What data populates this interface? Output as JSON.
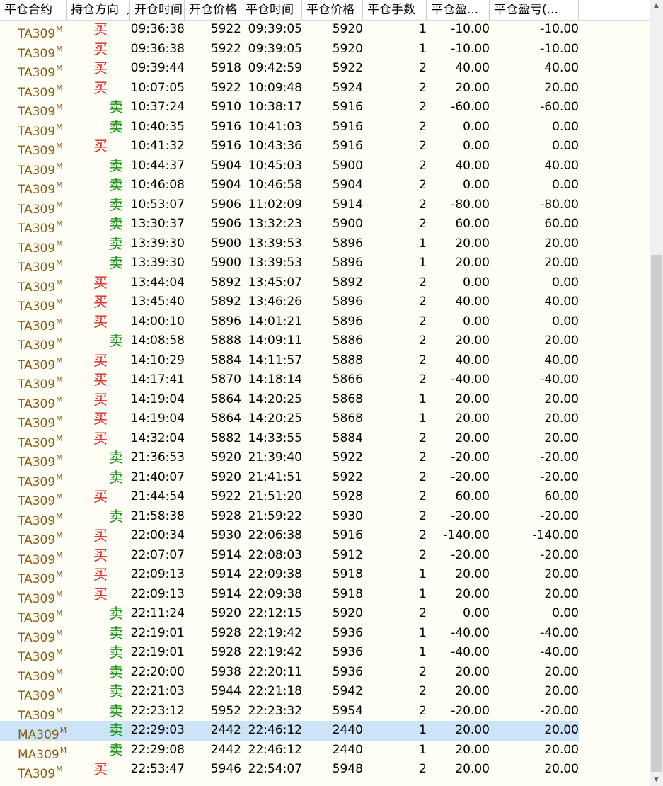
{
  "headers": {
    "contract": "平仓合约",
    "direction": "持仓方向",
    "open_time": "开仓时间",
    "open_price": "开仓价格",
    "close_time": "平仓时间",
    "close_price": "平仓价格",
    "lots": "平仓手数",
    "pnl": "平仓盈...",
    "pnl2": "平仓盈亏(..."
  },
  "rows": [
    {
      "contract": "TA309",
      "sup": "M",
      "dir": "买",
      "side": "buy",
      "otime": "09:36:38",
      "oprice": "5922",
      "ctime": "09:39:05",
      "cprice": "5920",
      "lots": "1",
      "pnl": "-10.00",
      "pnl2": "-10.00"
    },
    {
      "contract": "TA309",
      "sup": "M",
      "dir": "买",
      "side": "buy",
      "otime": "09:36:38",
      "oprice": "5922",
      "ctime": "09:39:05",
      "cprice": "5920",
      "lots": "1",
      "pnl": "-10.00",
      "pnl2": "-10.00"
    },
    {
      "contract": "TA309",
      "sup": "M",
      "dir": "买",
      "side": "buy",
      "otime": "09:39:44",
      "oprice": "5918",
      "ctime": "09:42:59",
      "cprice": "5922",
      "lots": "2",
      "pnl": "40.00",
      "pnl2": "40.00"
    },
    {
      "contract": "TA309",
      "sup": "M",
      "dir": "买",
      "side": "buy",
      "otime": "10:07:05",
      "oprice": "5922",
      "ctime": "10:09:48",
      "cprice": "5924",
      "lots": "2",
      "pnl": "20.00",
      "pnl2": "20.00"
    },
    {
      "contract": "TA309",
      "sup": "M",
      "dir": "卖",
      "side": "sell",
      "otime": "10:37:24",
      "oprice": "5910",
      "ctime": "10:38:17",
      "cprice": "5916",
      "lots": "2",
      "pnl": "-60.00",
      "pnl2": "-60.00"
    },
    {
      "contract": "TA309",
      "sup": "M",
      "dir": "卖",
      "side": "sell",
      "otime": "10:40:35",
      "oprice": "5916",
      "ctime": "10:41:03",
      "cprice": "5916",
      "lots": "2",
      "pnl": "0.00",
      "pnl2": "0.00"
    },
    {
      "contract": "TA309",
      "sup": "M",
      "dir": "买",
      "side": "buy",
      "otime": "10:41:32",
      "oprice": "5916",
      "ctime": "10:43:36",
      "cprice": "5916",
      "lots": "2",
      "pnl": "0.00",
      "pnl2": "0.00"
    },
    {
      "contract": "TA309",
      "sup": "M",
      "dir": "卖",
      "side": "sell",
      "otime": "10:44:37",
      "oprice": "5904",
      "ctime": "10:45:03",
      "cprice": "5900",
      "lots": "2",
      "pnl": "40.00",
      "pnl2": "40.00"
    },
    {
      "contract": "TA309",
      "sup": "M",
      "dir": "卖",
      "side": "sell",
      "otime": "10:46:08",
      "oprice": "5904",
      "ctime": "10:46:58",
      "cprice": "5904",
      "lots": "2",
      "pnl": "0.00",
      "pnl2": "0.00"
    },
    {
      "contract": "TA309",
      "sup": "M",
      "dir": "卖",
      "side": "sell",
      "otime": "10:53:07",
      "oprice": "5906",
      "ctime": "11:02:09",
      "cprice": "5914",
      "lots": "2",
      "pnl": "-80.00",
      "pnl2": "-80.00"
    },
    {
      "contract": "TA309",
      "sup": "M",
      "dir": "卖",
      "side": "sell",
      "otime": "13:30:37",
      "oprice": "5906",
      "ctime": "13:32:23",
      "cprice": "5900",
      "lots": "2",
      "pnl": "60.00",
      "pnl2": "60.00"
    },
    {
      "contract": "TA309",
      "sup": "M",
      "dir": "卖",
      "side": "sell",
      "otime": "13:39:30",
      "oprice": "5900",
      "ctime": "13:39:53",
      "cprice": "5896",
      "lots": "1",
      "pnl": "20.00",
      "pnl2": "20.00"
    },
    {
      "contract": "TA309",
      "sup": "M",
      "dir": "卖",
      "side": "sell",
      "otime": "13:39:30",
      "oprice": "5900",
      "ctime": "13:39:53",
      "cprice": "5896",
      "lots": "1",
      "pnl": "20.00",
      "pnl2": "20.00"
    },
    {
      "contract": "TA309",
      "sup": "M",
      "dir": "买",
      "side": "buy",
      "otime": "13:44:04",
      "oprice": "5892",
      "ctime": "13:45:07",
      "cprice": "5892",
      "lots": "2",
      "pnl": "0.00",
      "pnl2": "0.00"
    },
    {
      "contract": "TA309",
      "sup": "M",
      "dir": "买",
      "side": "buy",
      "otime": "13:45:40",
      "oprice": "5892",
      "ctime": "13:46:26",
      "cprice": "5896",
      "lots": "2",
      "pnl": "40.00",
      "pnl2": "40.00"
    },
    {
      "contract": "TA309",
      "sup": "M",
      "dir": "买",
      "side": "buy",
      "otime": "14:00:10",
      "oprice": "5896",
      "ctime": "14:01:21",
      "cprice": "5896",
      "lots": "2",
      "pnl": "0.00",
      "pnl2": "0.00"
    },
    {
      "contract": "TA309",
      "sup": "M",
      "dir": "卖",
      "side": "sell",
      "otime": "14:08:58",
      "oprice": "5888",
      "ctime": "14:09:11",
      "cprice": "5886",
      "lots": "2",
      "pnl": "20.00",
      "pnl2": "20.00"
    },
    {
      "contract": "TA309",
      "sup": "M",
      "dir": "买",
      "side": "buy",
      "otime": "14:10:29",
      "oprice": "5884",
      "ctime": "14:11:57",
      "cprice": "5888",
      "lots": "2",
      "pnl": "40.00",
      "pnl2": "40.00"
    },
    {
      "contract": "TA309",
      "sup": "M",
      "dir": "买",
      "side": "buy",
      "otime": "14:17:41",
      "oprice": "5870",
      "ctime": "14:18:14",
      "cprice": "5866",
      "lots": "2",
      "pnl": "-40.00",
      "pnl2": "-40.00"
    },
    {
      "contract": "TA309",
      "sup": "M",
      "dir": "买",
      "side": "buy",
      "otime": "14:19:04",
      "oprice": "5864",
      "ctime": "14:20:25",
      "cprice": "5868",
      "lots": "1",
      "pnl": "20.00",
      "pnl2": "20.00"
    },
    {
      "contract": "TA309",
      "sup": "M",
      "dir": "买",
      "side": "buy",
      "otime": "14:19:04",
      "oprice": "5864",
      "ctime": "14:20:25",
      "cprice": "5868",
      "lots": "1",
      "pnl": "20.00",
      "pnl2": "20.00"
    },
    {
      "contract": "TA309",
      "sup": "M",
      "dir": "买",
      "side": "buy",
      "otime": "14:32:04",
      "oprice": "5882",
      "ctime": "14:33:55",
      "cprice": "5884",
      "lots": "2",
      "pnl": "20.00",
      "pnl2": "20.00"
    },
    {
      "contract": "TA309",
      "sup": "M",
      "dir": "卖",
      "side": "sell",
      "otime": "21:36:53",
      "oprice": "5920",
      "ctime": "21:39:40",
      "cprice": "5922",
      "lots": "2",
      "pnl": "-20.00",
      "pnl2": "-20.00"
    },
    {
      "contract": "TA309",
      "sup": "M",
      "dir": "卖",
      "side": "sell",
      "otime": "21:40:07",
      "oprice": "5920",
      "ctime": "21:41:51",
      "cprice": "5922",
      "lots": "2",
      "pnl": "-20.00",
      "pnl2": "-20.00"
    },
    {
      "contract": "TA309",
      "sup": "M",
      "dir": "买",
      "side": "buy",
      "otime": "21:44:54",
      "oprice": "5922",
      "ctime": "21:51:20",
      "cprice": "5928",
      "lots": "2",
      "pnl": "60.00",
      "pnl2": "60.00"
    },
    {
      "contract": "TA309",
      "sup": "M",
      "dir": "卖",
      "side": "sell",
      "otime": "21:58:38",
      "oprice": "5928",
      "ctime": "21:59:22",
      "cprice": "5930",
      "lots": "2",
      "pnl": "-20.00",
      "pnl2": "-20.00"
    },
    {
      "contract": "TA309",
      "sup": "M",
      "dir": "买",
      "side": "buy",
      "otime": "22:00:34",
      "oprice": "5930",
      "ctime": "22:06:38",
      "cprice": "5916",
      "lots": "2",
      "pnl": "-140.00",
      "pnl2": "-140.00"
    },
    {
      "contract": "TA309",
      "sup": "M",
      "dir": "买",
      "side": "buy",
      "otime": "22:07:07",
      "oprice": "5914",
      "ctime": "22:08:03",
      "cprice": "5912",
      "lots": "2",
      "pnl": "-20.00",
      "pnl2": "-20.00"
    },
    {
      "contract": "TA309",
      "sup": "M",
      "dir": "买",
      "side": "buy",
      "otime": "22:09:13",
      "oprice": "5914",
      "ctime": "22:09:38",
      "cprice": "5918",
      "lots": "1",
      "pnl": "20.00",
      "pnl2": "20.00"
    },
    {
      "contract": "TA309",
      "sup": "M",
      "dir": "买",
      "side": "buy",
      "otime": "22:09:13",
      "oprice": "5914",
      "ctime": "22:09:38",
      "cprice": "5918",
      "lots": "1",
      "pnl": "20.00",
      "pnl2": "20.00"
    },
    {
      "contract": "TA309",
      "sup": "M",
      "dir": "卖",
      "side": "sell",
      "otime": "22:11:24",
      "oprice": "5920",
      "ctime": "22:12:15",
      "cprice": "5920",
      "lots": "2",
      "pnl": "0.00",
      "pnl2": "0.00"
    },
    {
      "contract": "TA309",
      "sup": "M",
      "dir": "卖",
      "side": "sell",
      "otime": "22:19:01",
      "oprice": "5928",
      "ctime": "22:19:42",
      "cprice": "5936",
      "lots": "1",
      "pnl": "-40.00",
      "pnl2": "-40.00"
    },
    {
      "contract": "TA309",
      "sup": "M",
      "dir": "卖",
      "side": "sell",
      "otime": "22:19:01",
      "oprice": "5928",
      "ctime": "22:19:42",
      "cprice": "5936",
      "lots": "1",
      "pnl": "-40.00",
      "pnl2": "-40.00"
    },
    {
      "contract": "TA309",
      "sup": "M",
      "dir": "卖",
      "side": "sell",
      "otime": "22:20:00",
      "oprice": "5938",
      "ctime": "22:20:11",
      "cprice": "5936",
      "lots": "2",
      "pnl": "20.00",
      "pnl2": "20.00"
    },
    {
      "contract": "TA309",
      "sup": "M",
      "dir": "卖",
      "side": "sell",
      "otime": "22:21:03",
      "oprice": "5944",
      "ctime": "22:21:18",
      "cprice": "5942",
      "lots": "2",
      "pnl": "20.00",
      "pnl2": "20.00"
    },
    {
      "contract": "TA309",
      "sup": "M",
      "dir": "卖",
      "side": "sell",
      "otime": "22:23:12",
      "oprice": "5952",
      "ctime": "22:23:32",
      "cprice": "5954",
      "lots": "2",
      "pnl": "-20.00",
      "pnl2": "-20.00"
    },
    {
      "contract": "MA309",
      "sup": "M",
      "dir": "卖",
      "side": "sell",
      "otime": "22:29:03",
      "oprice": "2442",
      "ctime": "22:46:12",
      "cprice": "2440",
      "lots": "1",
      "pnl": "20.00",
      "pnl2": "20.00",
      "selected": true
    },
    {
      "contract": "MA309",
      "sup": "M",
      "dir": "卖",
      "side": "sell",
      "otime": "22:29:08",
      "oprice": "2442",
      "ctime": "22:46:12",
      "cprice": "2440",
      "lots": "1",
      "pnl": "20.00",
      "pnl2": "20.00"
    },
    {
      "contract": "TA309",
      "sup": "M",
      "dir": "买",
      "side": "buy",
      "otime": "22:53:47",
      "oprice": "5946",
      "ctime": "22:54:07",
      "cprice": "5948",
      "lots": "2",
      "pnl": "20.00",
      "pnl2": "20.00"
    }
  ],
  "colors": {
    "buy": "#e02020",
    "sell": "#109010",
    "contract": "#8b5a16",
    "selected": "#cce4f7"
  },
  "scrollbar": {
    "up_icon": "scroll-up-arrow-icon",
    "down_icon": "scroll-down-arrow-icon"
  }
}
